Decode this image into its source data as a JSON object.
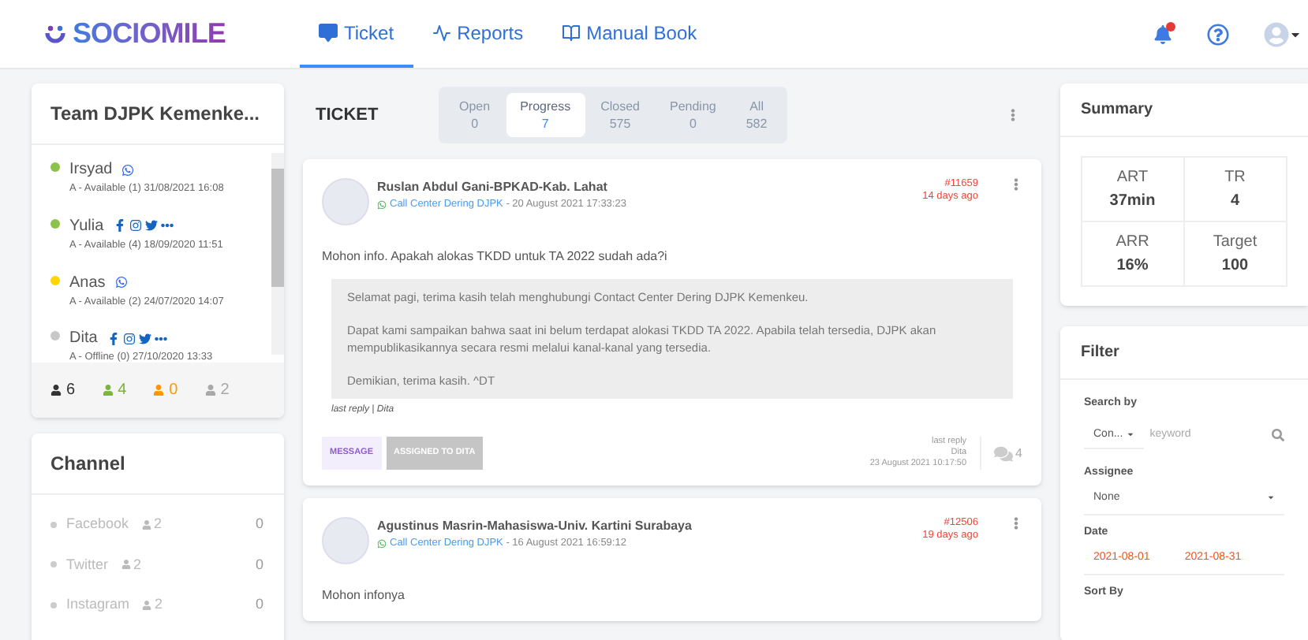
{
  "brand": {
    "name": "SOCIOMILE"
  },
  "nav": [
    {
      "label": "Ticket",
      "selected": true
    },
    {
      "label": "Reports",
      "selected": false
    },
    {
      "label": "Manual Book",
      "selected": false
    }
  ],
  "header_icons": {
    "notification_dot": true
  },
  "team": {
    "title": "Team DJPK Kemenke...",
    "agents": [
      {
        "name": "Irsyad",
        "color": "#8bc34a",
        "channels": [
          {
            "kind": "whatsapp"
          }
        ],
        "detail": "A - Available (1) 31/08/2021 16:08"
      },
      {
        "name": "Yulia",
        "color": "#8bc34a",
        "channels": [
          {
            "kind": "facebook"
          },
          {
            "kind": "instagram"
          },
          {
            "kind": "twitter"
          },
          {
            "kind": "more"
          }
        ],
        "detail": "A - Available (4) 18/09/2020 11:51"
      },
      {
        "name": "Anas",
        "color": "#ffd600",
        "channels": [
          {
            "kind": "whatsapp"
          }
        ],
        "detail": "A - Available (2) 24/07/2020 14:07"
      },
      {
        "name": "Dita",
        "color": "#c8c8c8",
        "channels": [
          {
            "kind": "facebook"
          },
          {
            "kind": "instagram"
          },
          {
            "kind": "twitter"
          },
          {
            "kind": "more"
          }
        ],
        "detail": "A - Offline (0) 27/10/2020 13:33"
      }
    ],
    "counts": [
      {
        "value": "6",
        "color": "#333333"
      },
      {
        "value": "4",
        "color": "#7cb342"
      },
      {
        "value": "0",
        "color": "#ff9800"
      },
      {
        "value": "2",
        "color": "#a8a8a8"
      }
    ]
  },
  "channel": {
    "title": "Channel",
    "items": [
      {
        "name": "Facebook",
        "agents": "2",
        "count": "0"
      },
      {
        "name": "Twitter",
        "agents": "2",
        "count": "0"
      },
      {
        "name": "Instagram",
        "agents": "2",
        "count": "0"
      }
    ]
  },
  "ticket": {
    "title": "TICKET",
    "tabs": [
      {
        "label": "Open",
        "count": "0",
        "selected": false
      },
      {
        "label": "Progress",
        "count": "7",
        "selected": true
      },
      {
        "label": "Closed",
        "count": "575",
        "selected": false
      },
      {
        "label": "Pending",
        "count": "0",
        "selected": false
      },
      {
        "label": "All",
        "count": "582",
        "selected": false
      }
    ],
    "items": [
      {
        "name": "Ruslan Abdul Gani-BPKAD-Kab. Lahat",
        "source": "Call Center Dering DJPK",
        "date": " - 20 August 2021 17:33:23",
        "number": "#11659",
        "age": "14 days ago",
        "message": "Mohon info. Apakah alokas TKDD untuk TA 2022 sudah ada?i",
        "reply": [
          "Selamat pagi, terima kasih telah menghubungi Contact Center Dering DJPK Kemenkeu.",
          "Dapat kami sampaikan bahwa saat ini belum terdapat alokasi TKDD TA 2022. Apabila telah tersedia, DJPK akan mempublikasikannya secara resmi melalui kanal-kanal yang tersedia.",
          "Demikian, terima kasih. ^DT"
        ],
        "last_reply_note": "last reply | Dita",
        "tags": [
          {
            "label": "MESSAGE",
            "kind": "type"
          },
          {
            "label": "ASSIGNED TO DITA",
            "kind": "assigned"
          }
        ],
        "last_reply": {
          "label": "last reply",
          "by": "Dita",
          "date": "23 August 2021 10:17:50"
        },
        "comments": "4"
      },
      {
        "name": "Agustinus Masrin-Mahasiswa-Univ. Kartini Surabaya",
        "source": "Call Center Dering DJPK",
        "date": " - 16 August 2021 16:59:12",
        "number": "#12506",
        "age": "19 days ago",
        "message": "Mohon infonya"
      }
    ]
  },
  "summary": {
    "title": "Summary",
    "cells": [
      {
        "label": "ART",
        "value": "37min"
      },
      {
        "label": "TR",
        "value": "4"
      },
      {
        "label": "ARR",
        "value": "16%"
      },
      {
        "label": "Target",
        "value": "100"
      }
    ]
  },
  "filter": {
    "title": "Filter",
    "search_label": "Search by",
    "search_by": "Con...",
    "search_placeholder": "keyword",
    "assignee_label": "Assignee",
    "assignee": "None",
    "date_label": "Date",
    "date_from": "2021-08-01",
    "date_to": "2021-08-31",
    "sort_label": "Sort By"
  }
}
